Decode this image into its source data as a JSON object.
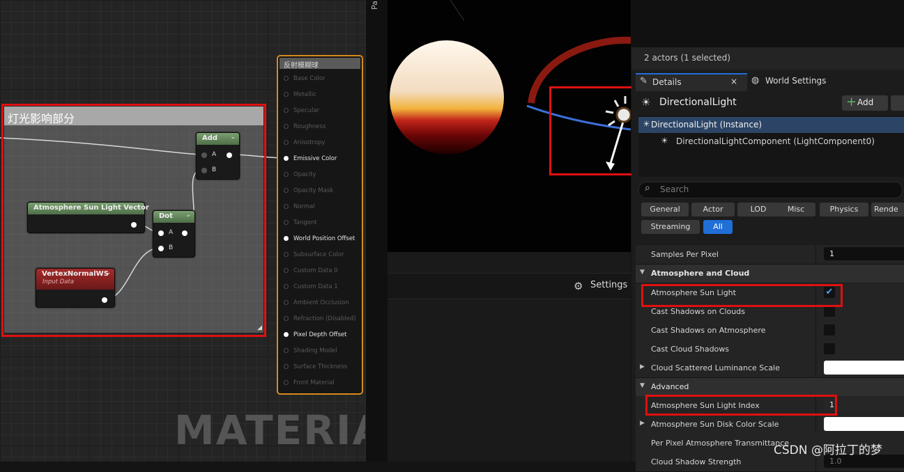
{
  "graph": {
    "comment_title": "灯光影响部分",
    "nodes": {
      "add": {
        "title": "Add",
        "pin_a": "A",
        "pin_b": "B"
      },
      "dot": {
        "title": "Dot",
        "pin_a": "A",
        "pin_b": "B"
      },
      "atmos": {
        "title": "Atmosphere Sun Light Vector"
      },
      "vertex": {
        "title": "VertexNormalWS",
        "subtitle": "Input Data"
      }
    },
    "material_node": {
      "title": "反射模糊球",
      "inputs": [
        {
          "label": "Base Color",
          "active": false
        },
        {
          "label": "Metallic",
          "active": false
        },
        {
          "label": "Specular",
          "active": false
        },
        {
          "label": "Roughness",
          "active": false
        },
        {
          "label": "Anisotropy",
          "active": false
        },
        {
          "label": "Emissive Color",
          "active": true
        },
        {
          "label": "Opacity",
          "active": false
        },
        {
          "label": "Opacity Mask",
          "active": false
        },
        {
          "label": "Normal",
          "active": false
        },
        {
          "label": "Tangent",
          "active": false
        },
        {
          "label": "World Position Offset",
          "active": true
        },
        {
          "label": "Subsurface Color",
          "active": false
        },
        {
          "label": "Custom Data 0",
          "active": false
        },
        {
          "label": "Custom Data 1",
          "active": false
        },
        {
          "label": "Ambient Occlusion",
          "active": false
        },
        {
          "label": "Refraction (Disabled)",
          "active": false
        },
        {
          "label": "Pixel Depth Offset",
          "active": true
        },
        {
          "label": "Shading Model",
          "active": false
        },
        {
          "label": "Surface Thickness",
          "active": false
        },
        {
          "label": "Front Material",
          "active": false
        }
      ]
    },
    "watermark": "MATERIAL"
  },
  "side_tab_label": "Pa",
  "viewport": {
    "settings_label": "Settings"
  },
  "details": {
    "actors_text": "2 actors (1 selected)",
    "tab_details": "Details",
    "tab_world": "World Settings",
    "actor_title": "DirectionalLight",
    "add_label": "Add",
    "tree": [
      "DirectionalLight (Instance)",
      "DirectionalLightComponent (LightComponent0)"
    ],
    "search_placeholder": "Search",
    "filters": [
      "General",
      "Actor",
      "LOD",
      "Misc",
      "Physics",
      "Rende",
      "Streaming",
      "All"
    ],
    "rows": {
      "samples": {
        "name": "Samples Per Pixel",
        "value": "1"
      },
      "cat_atmos": "Atmosphere and Cloud",
      "atmos_sun": {
        "name": "Atmosphere Sun Light",
        "checked": true
      },
      "cast_clouds": {
        "name": "Cast Shadows on Clouds"
      },
      "cast_atmos": {
        "name": "Cast Shadows on Atmosphere"
      },
      "cast_cloud_shadows": {
        "name": "Cast Cloud Shadows"
      },
      "cloud_scatter": {
        "name": "Cloud Scattered Luminance Scale"
      },
      "cat_adv": "Advanced",
      "sun_index": {
        "name": "Atmosphere Sun Light Index",
        "value": "1"
      },
      "disk_color": {
        "name": "Atmosphere Sun Disk Color Scale"
      },
      "per_pixel": {
        "name": "Per Pixel Atmosphere Transmittance"
      },
      "cloud_strength": {
        "name": "Cloud Shadow Strength",
        "value": "1.0"
      }
    }
  },
  "watermark_csdn": "CSDN @阿拉丁的梦",
  "colors": {
    "highlight": "#e01010",
    "accent": "#1f6fd6",
    "material_border": "#d98b1c"
  }
}
